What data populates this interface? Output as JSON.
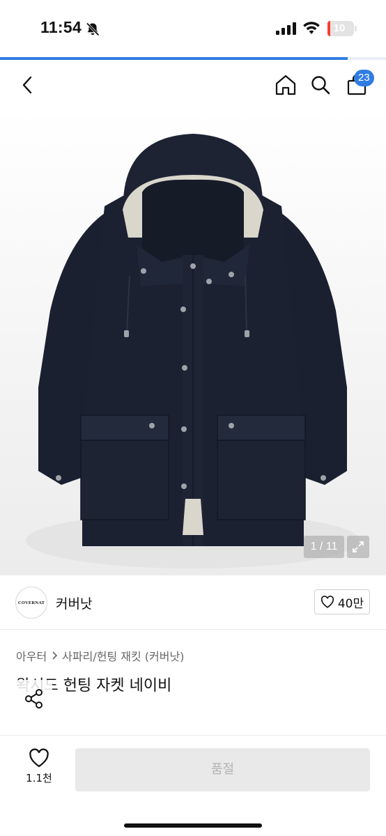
{
  "status_bar": {
    "time": "11:54",
    "battery_level": "10",
    "battery_fraction": 0.1,
    "icons": [
      "bell-slash-icon",
      "signal-icon",
      "wifi-icon",
      "battery-icon"
    ]
  },
  "page_loading_progress": 0.9,
  "nav": {
    "icons": [
      "back-icon",
      "home-icon",
      "search-icon",
      "cart-icon"
    ],
    "cart_badge": "23"
  },
  "gallery": {
    "counter": "1 / 11",
    "expand_icon": "expand-icon"
  },
  "seller": {
    "logo_text": "COVERNAT",
    "name": "커버낫",
    "like_count": "40만"
  },
  "product": {
    "breadcrumb": [
      "아우터",
      "사파리/헌팅 재킷 (커버낫)"
    ],
    "title": "왁시드 헌팅 자켓 네이비"
  },
  "bottom": {
    "wish_count": "1.1천",
    "soldout_label": "품절"
  },
  "colors": {
    "accent": "#2f7de1",
    "jacket": "#1b2130",
    "soldout_bg": "#e9e9e9"
  }
}
